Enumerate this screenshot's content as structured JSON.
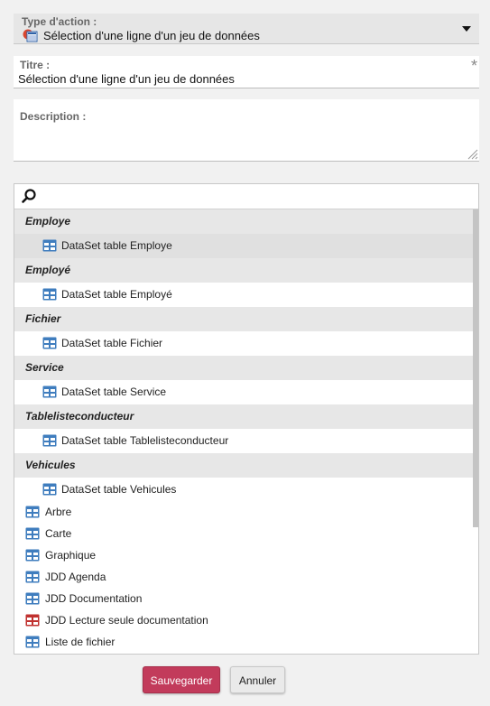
{
  "type_action": {
    "label": "Type d'action :",
    "value": "Sélection d'une ligne d'un jeu de données",
    "icon": "dataset-select-icon"
  },
  "titre": {
    "label": "Titre :",
    "value": "Sélection d'une ligne d'un jeu de données",
    "required_mark": "*"
  },
  "description": {
    "label": "Description :",
    "value": ""
  },
  "picker": {
    "search_value": "",
    "required_mark": "*",
    "groups": [
      {
        "name": "Employe",
        "items": [
          "DataSet table Employe"
        ]
      },
      {
        "name": "Employé",
        "items": [
          "DataSet table Employé"
        ]
      },
      {
        "name": "Fichier",
        "items": [
          "DataSet table Fichier"
        ]
      },
      {
        "name": "Service",
        "items": [
          "DataSet table Service"
        ]
      },
      {
        "name": "Tablelisteconducteur",
        "items": [
          "DataSet table Tablelisteconducteur"
        ]
      },
      {
        "name": "Vehicules",
        "items": [
          "DataSet table Vehicules"
        ]
      }
    ],
    "items": [
      {
        "label": "Arbre",
        "icon_color": "#3f7dbe"
      },
      {
        "label": "Carte",
        "icon_color": "#3f7dbe"
      },
      {
        "label": "Graphique",
        "icon_color": "#3f7dbe"
      },
      {
        "label": "JDD Agenda",
        "icon_color": "#3f7dbe"
      },
      {
        "label": "JDD Documentation",
        "icon_color": "#3f7dbe"
      },
      {
        "label": "JDD Lecture seule documentation",
        "icon_color": "#c0312f"
      },
      {
        "label": "Liste de fichier",
        "icon_color": "#3f7dbe"
      }
    ],
    "selected": "DataSet table Employe"
  },
  "buttons": {
    "save": "Sauvegarder",
    "cancel": "Annuler"
  },
  "colors": {
    "accent": "#c23b5b",
    "table_icon_blue": "#3f7dbe",
    "table_icon_red": "#c0312f"
  }
}
